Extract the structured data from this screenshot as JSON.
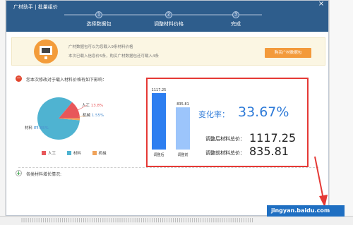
{
  "dialog": {
    "title": "广材助手 | 批量组价",
    "close_glyph": "×"
  },
  "steps": [
    {
      "num": "1",
      "label": "选择数据包"
    },
    {
      "num": "2",
      "label": "调整材料价格"
    },
    {
      "num": "3",
      "label": "完成"
    }
  ],
  "banner": {
    "line1": "广材数据包可以为您载入9条材料价格",
    "line2": "本次已载入信息价5条，购买广材数据包还可载入4条",
    "button_label": "购买广材数据包"
  },
  "section": {
    "minus_glyph": "−",
    "title": "您本次修改对于载入材料价格有如下影响："
  },
  "pie": {
    "labels": {
      "labor": "人工",
      "labor_pct": "13.8%",
      "machine": "机械",
      "machine_pct": "1.55%",
      "material": "材料",
      "material_pct": "84.65%"
    },
    "legend": [
      "人工",
      "材料",
      "机械"
    ],
    "colors": {
      "labor": "#e8575a",
      "material": "#4fb3d1",
      "machine": "#f0a35a"
    }
  },
  "chart_data": {
    "type": "bar",
    "categories": [
      "调整后",
      "调整前"
    ],
    "values": [
      1117.25,
      835.81
    ],
    "value_labels": [
      "1117.25",
      "835.81"
    ],
    "colors": [
      "#2d7ef0",
      "#9cc5fb"
    ]
  },
  "summary": {
    "rate_label": "变化率：",
    "rate_value": "33.67%",
    "after_label": "调整后材料总价：",
    "after_value": "1117.25",
    "before_label": "调整前材料总价：",
    "before_value": "835.81"
  },
  "section2": {
    "plus_glyph": "+",
    "title": "各类材料增长情况:"
  },
  "watermark": "jingyan.baidu.com",
  "bottom_strip": "|||||||||||||||||||||||||||||||||||||||||||||||||||||||||||||||||||||||||||||||||||||||||||||||||||||||||||||"
}
